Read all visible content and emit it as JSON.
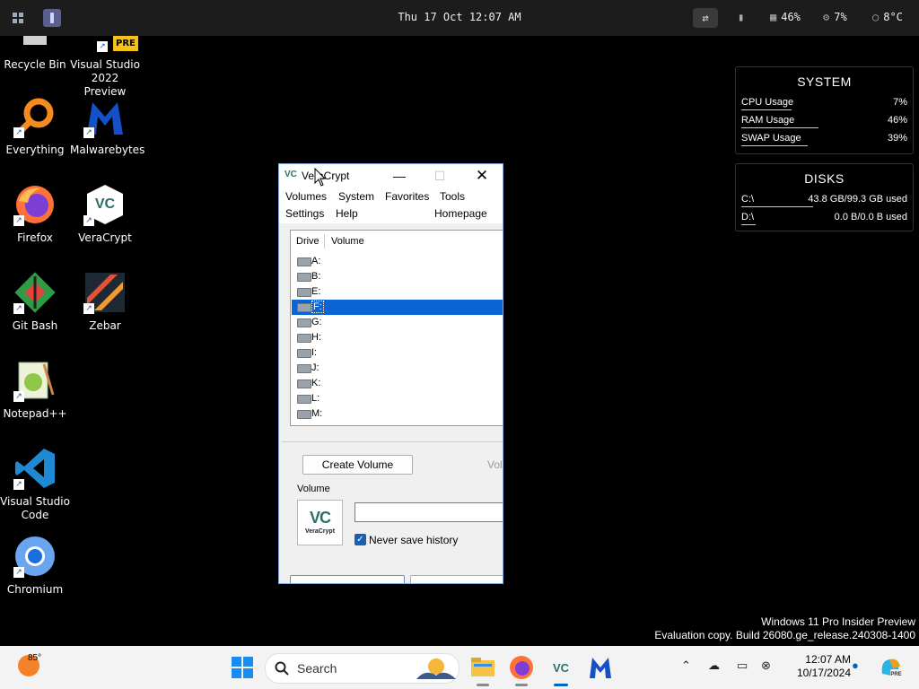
{
  "topbar": {
    "clock": "Thu 17 Oct 12:07 AM",
    "stats": [
      {
        "icon": "memory-icon",
        "glyph": "▦",
        "value": "46%"
      },
      {
        "icon": "cpu-icon",
        "glyph": "⚙",
        "value": "7%"
      },
      {
        "icon": "weather-icon",
        "glyph": "○",
        "value": "8°C"
      }
    ]
  },
  "desktop": {
    "icons": [
      {
        "label": "Recycle Bin",
        "icon": "recycle-bin-icon"
      },
      {
        "label": "Visual Studio 2022 Preview",
        "badge": "PRE",
        "icon": "visual-studio-icon"
      },
      {
        "label": "Everything",
        "icon": "everything-icon"
      },
      {
        "label": "Malwarebytes",
        "icon": "malwarebytes-icon"
      },
      {
        "label": "Firefox",
        "icon": "firefox-icon"
      },
      {
        "label": "VeraCrypt",
        "icon": "veracrypt-icon"
      },
      {
        "label": "Git Bash",
        "icon": "git-bash-icon"
      },
      {
        "label": "Zebar",
        "icon": "zebar-icon"
      },
      {
        "label": "Notepad++",
        "icon": "notepadpp-icon"
      },
      {
        "label": "Visual Studio Code",
        "icon": "vscode-icon"
      },
      {
        "label": "Chromium",
        "icon": "chromium-icon"
      }
    ]
  },
  "widgets": {
    "system": {
      "title": "SYSTEM",
      "rows": [
        {
          "label": "CPU Usage",
          "value": "7%",
          "fraction": 0.07
        },
        {
          "label": "RAM Usage",
          "value": "46%",
          "fraction": 0.46
        },
        {
          "label": "SWAP Usage",
          "value": "39%",
          "fraction": 0.39
        }
      ]
    },
    "disks": {
      "title": "DISKS",
      "rows": [
        {
          "label": "C:\\",
          "value": "43.8 GB/99.3 GB used",
          "fraction": 0.44
        },
        {
          "label": "D:\\",
          "value": "0.0 B/0.0 B used",
          "fraction": 0.0
        }
      ]
    }
  },
  "veracrypt": {
    "title": "VeraCrypt",
    "menu": [
      "Volumes",
      "System",
      "Favorites",
      "Tools",
      "Settings",
      "Help",
      "Homepage"
    ],
    "columns": {
      "drive": "Drive",
      "volume": "Volume"
    },
    "drives": [
      "A:",
      "B:",
      "E:",
      "F:",
      "G:",
      "H:",
      "I:",
      "J:",
      "K:",
      "L:",
      "M:"
    ],
    "selected_drive": "F:",
    "create_volume": "Create Volume",
    "volume_properties_partial": "Vol",
    "volume_group_label": "Volume",
    "logo_text": "VeraCrypt",
    "volume_path": "",
    "never_save_history": "Never save history",
    "never_save_history_checked": true
  },
  "watermark": {
    "line1": "Windows 11 Pro Insider Preview",
    "line2": "Evaluation copy. Build 26080.ge_release.240308-1400"
  },
  "taskbar": {
    "weather_temp": "85°",
    "search_label": "Search",
    "time": "12:07 AM",
    "date": "10/17/2024"
  },
  "colors": {
    "accent": "#0067c0",
    "selection": "#0a64d6",
    "veracrypt_teal": "#2b6f6a"
  }
}
